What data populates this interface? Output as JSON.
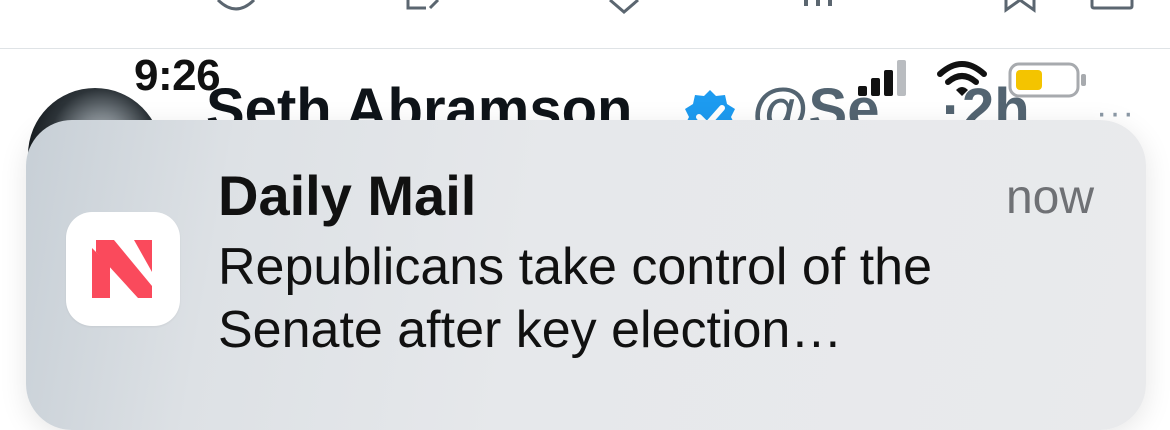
{
  "background_app": {
    "action_icons": [
      "reply-icon",
      "retweet-icon",
      "like-icon",
      "views-icon",
      "bookmark-icon",
      "share-icon"
    ],
    "tweet": {
      "author": "Seth Abramson",
      "verified_icon": "verified-badge-icon",
      "handle": "@Se",
      "separator": "·",
      "age": "2h",
      "more_icon": "···"
    }
  },
  "status_bar": {
    "time": "9:26",
    "icons": [
      "cellular-signal-icon",
      "wifi-icon",
      "battery-icon"
    ],
    "battery_color": "#f4c400"
  },
  "notification": {
    "app_icon": "apple-news-icon",
    "app_icon_color": "#fa4a5c",
    "app_name": "Daily Mail",
    "time": "now",
    "body": "Republicans take control of the Senate after key election…"
  }
}
